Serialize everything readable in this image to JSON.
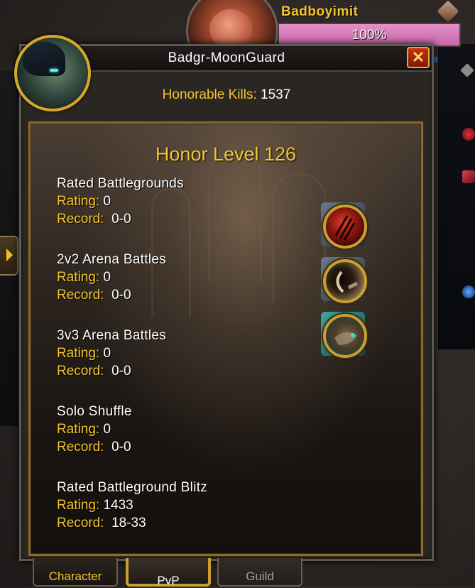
{
  "target": {
    "name": "Badboyimit",
    "health_text": "100%"
  },
  "panel": {
    "title": "Badgr-MoonGuard",
    "honorable_kills_label": "Honorable Kills:",
    "honorable_kills_value": "1537",
    "honor_level": "Honor Level 126",
    "brackets": [
      {
        "name": "Rated Battlegrounds",
        "rating_label": "Rating:",
        "rating": "0",
        "record_label": "Record:",
        "record": "0-0"
      },
      {
        "name": "2v2 Arena Battles",
        "rating_label": "Rating:",
        "rating": "0",
        "record_label": "Record:",
        "record": "0-0"
      },
      {
        "name": "3v3 Arena Battles",
        "rating_label": "Rating:",
        "rating": "0",
        "record_label": "Record:",
        "record": "0-0"
      },
      {
        "name": "Solo Shuffle",
        "rating_label": "Rating:",
        "rating": "0",
        "record_label": "Record:",
        "record": "0-0"
      },
      {
        "name": "Rated Battleground Blitz",
        "rating_label": "Rating:",
        "rating": "1433",
        "record_label": "Record:",
        "record": "18-33"
      }
    ],
    "medals": [
      "rated-battlegrounds-medal-icon",
      "arena-2v2-medal-icon",
      "arena-3v3-medal-icon"
    ],
    "close_glyph": "✕"
  },
  "tabs": {
    "character": "Character",
    "pvp": "PvP",
    "guild": "Guild"
  },
  "colors": {
    "gold_text": "#f4c430",
    "health_bar": "#d47cb8",
    "frame_border": "#8a6a30"
  }
}
